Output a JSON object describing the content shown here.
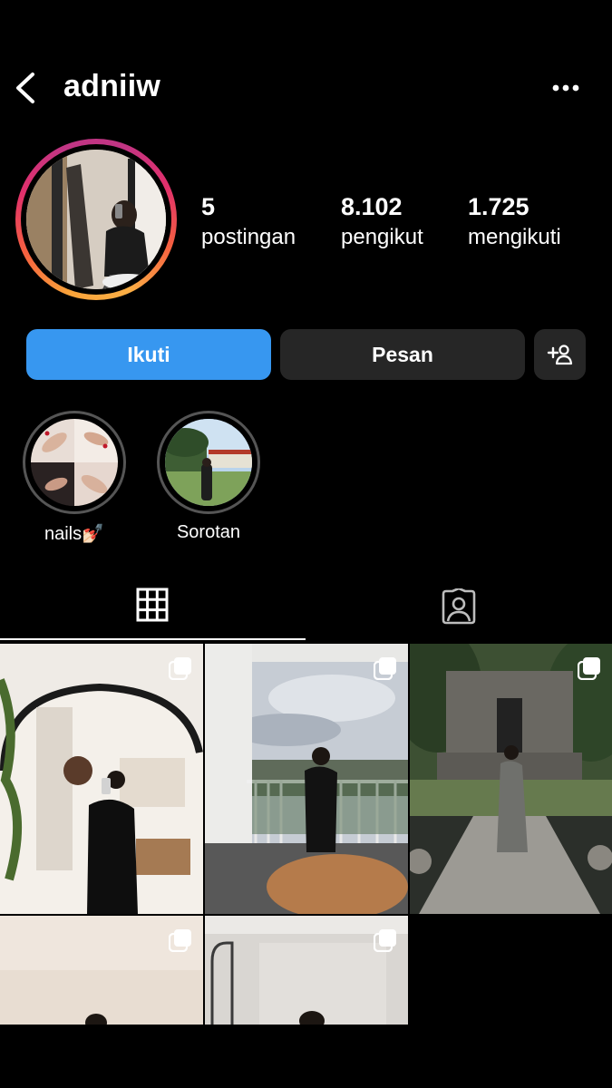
{
  "header": {
    "username": "adniiw",
    "back_icon": "chevron-left-icon",
    "menu_icon": "more-horizontal-icon"
  },
  "profile": {
    "avatar_icon": "profile-photo"
  },
  "stats": [
    {
      "value": "5",
      "label": "postingan"
    },
    {
      "value": "8.102",
      "label": "pengikut"
    },
    {
      "value": "1.725",
      "label": "mengikuti"
    }
  ],
  "actions": {
    "follow_label": "Ikuti",
    "message_label": "Pesan",
    "add_icon": "add-person-icon"
  },
  "highlights": [
    {
      "label": "nails💅🏻"
    },
    {
      "label": "Sorotan"
    }
  ],
  "tabs": [
    {
      "icon": "grid-icon",
      "active": true
    },
    {
      "icon": "tagged-person-icon",
      "active": false
    }
  ],
  "colors": {
    "accent": "#3797f0",
    "button_secondary": "#262626",
    "background": "#000000"
  },
  "posts": [
    {
      "type": "carousel"
    },
    {
      "type": "carousel"
    },
    {
      "type": "carousel"
    },
    {
      "type": "carousel"
    },
    {
      "type": "carousel"
    }
  ]
}
